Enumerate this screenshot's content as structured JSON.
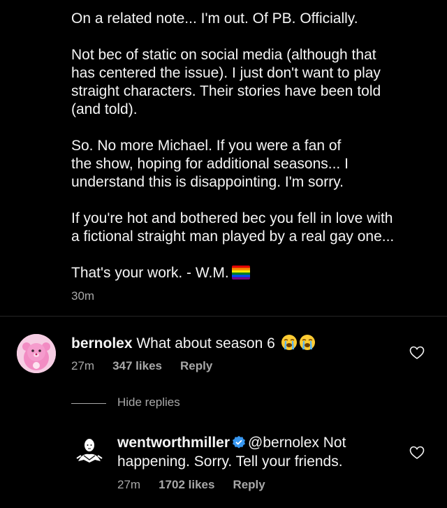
{
  "post": {
    "paragraphs": [
      "On a related note... I'm out. Of PB. Officially.",
      "Not bec of static on social media (although that\nhas centered the issue). I just don't want to play\nstraight characters. Their stories have been told\n(and told).",
      "So. No more Michael. If you were a fan of\nthe show, hoping for additional seasons... I\nunderstand this is disappointing. I'm sorry.",
      "If you're hot and bothered bec you fell in love with\na fictional straight man played by a real gay one...",
      "That's your work. - W.M."
    ],
    "flag_icon": "rainbow-flag",
    "time": "30m"
  },
  "comment": {
    "username": "bernolex",
    "text": " What about season 6 ",
    "emoji_icons": [
      "loudly-crying-face",
      "loudly-crying-face"
    ],
    "time": "27m",
    "likes": "347 likes",
    "reply_label": "Reply"
  },
  "hide_replies_label": "Hide replies",
  "reply": {
    "username": "wentworthmiller",
    "mention": "@bernolex",
    "text_line1": " Not",
    "text_line2": "happening. Sorry. Tell your friends.",
    "time": "27m",
    "likes": "1702 likes",
    "reply_label": "Reply"
  },
  "colors": {
    "background": "#000000",
    "text": "#f5f5f5",
    "muted": "#a8a8a8",
    "verified": "#3897f0"
  }
}
